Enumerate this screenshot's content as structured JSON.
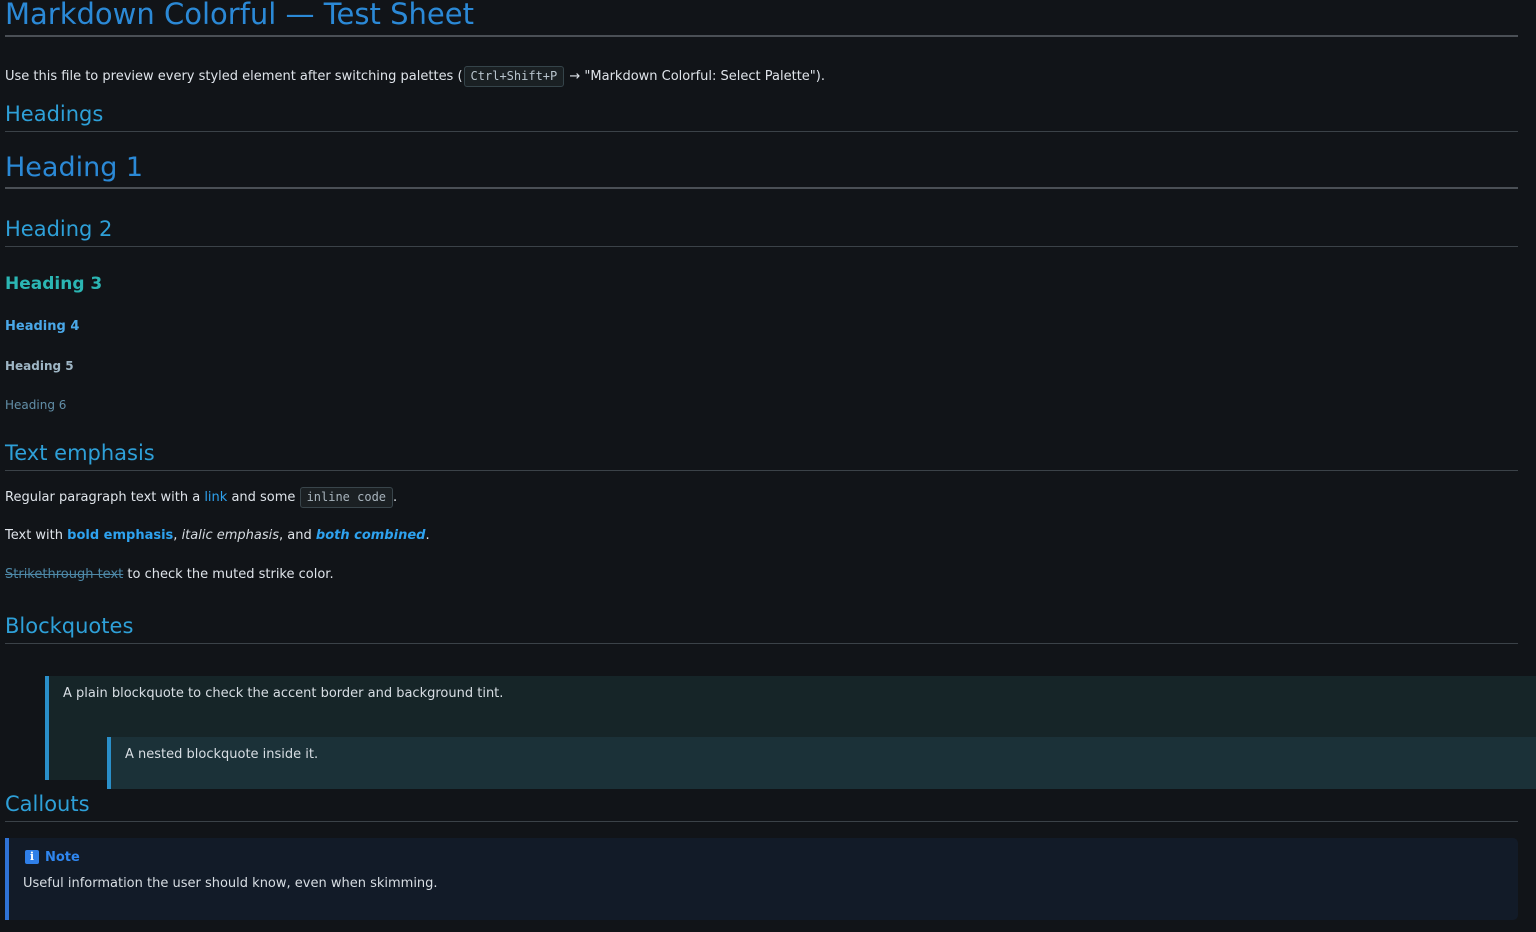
{
  "document": {
    "title": "Markdown Colorful — Test Sheet",
    "intro": {
      "before": "Use this file to preview every styled element after switching palettes (",
      "shortcut": "Ctrl+Shift+P",
      "after": " → \"Markdown Colorful: Select Palette\")."
    }
  },
  "sections": {
    "headings": {
      "title": "Headings",
      "examples": {
        "h1": "Heading 1",
        "h2": "Heading 2",
        "h3": "Heading 3",
        "h4": "Heading 4",
        "h5": "Heading 5",
        "h6": "Heading 6"
      }
    },
    "text_emphasis": {
      "title": "Text emphasis",
      "paragraph1": {
        "before_link": "Regular paragraph text with a ",
        "link": "link",
        "between": " and some ",
        "inline_code": "inline code",
        "after": "."
      },
      "paragraph2": {
        "prefix": "Text with ",
        "bold": "bold emphasis",
        "comma1": ", ",
        "italic": "italic emphasis",
        "middle": ", and ",
        "both": "both combined",
        "end": "."
      },
      "paragraph3": {
        "strike": "Strikethrough text",
        "rest": " to check the muted strike color."
      }
    },
    "blockquotes": {
      "title": "Blockquotes",
      "plain": "A plain blockquote to check the accent border and background tint.",
      "nested": "A nested blockquote inside it."
    },
    "callouts": {
      "title": "Callouts",
      "note": {
        "icon": "i",
        "label": "Note",
        "body": "Useful information the user should know, even when skimming."
      }
    }
  },
  "colors": {
    "background": "#111418",
    "accent": "#2ea0d8",
    "link": "#2ea2ef",
    "callout_note": "#2f73d6"
  }
}
